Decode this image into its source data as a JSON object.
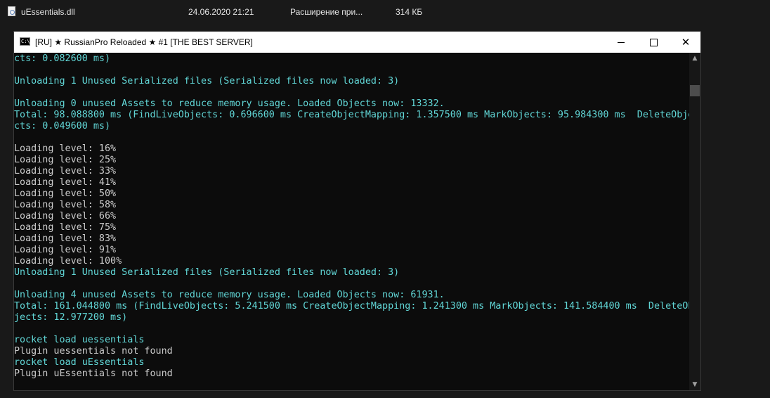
{
  "file_row": {
    "name": "uEssentials.dll",
    "date": "24.06.2020 21:21",
    "type": "Расширение при...",
    "size": "314 КБ"
  },
  "window": {
    "icon_text": "C:\\",
    "title": "[RU] ★ RussianPro Reloaded ★ #1 [THE BEST SERVER]"
  },
  "console_lines": [
    {
      "text": "cts: 0.082600 ms)",
      "color": "cyan"
    },
    {
      "text": "",
      "color": "white"
    },
    {
      "text": "Unloading 1 Unused Serialized files (Serialized files now loaded: 3)",
      "color": "cyan"
    },
    {
      "text": "",
      "color": "white"
    },
    {
      "text": "Unloading 0 unused Assets to reduce memory usage. Loaded Objects now: 13332.",
      "color": "cyan"
    },
    {
      "text": "Total: 98.088800 ms (FindLiveObjects: 0.696600 ms CreateObjectMapping: 1.357500 ms MarkObjects: 95.984300 ms  DeleteObje",
      "color": "cyan"
    },
    {
      "text": "cts: 0.049600 ms)",
      "color": "cyan"
    },
    {
      "text": "",
      "color": "white"
    },
    {
      "text": "Loading level: 16%",
      "color": "white"
    },
    {
      "text": "Loading level: 25%",
      "color": "white"
    },
    {
      "text": "Loading level: 33%",
      "color": "white"
    },
    {
      "text": "Loading level: 41%",
      "color": "white"
    },
    {
      "text": "Loading level: 50%",
      "color": "white"
    },
    {
      "text": "Loading level: 58%",
      "color": "white"
    },
    {
      "text": "Loading level: 66%",
      "color": "white"
    },
    {
      "text": "Loading level: 75%",
      "color": "white"
    },
    {
      "text": "Loading level: 83%",
      "color": "white"
    },
    {
      "text": "Loading level: 91%",
      "color": "white"
    },
    {
      "text": "Loading level: 100%",
      "color": "white"
    },
    {
      "text": "Unloading 1 Unused Serialized files (Serialized files now loaded: 3)",
      "color": "cyan"
    },
    {
      "text": "",
      "color": "white"
    },
    {
      "text": "Unloading 4 unused Assets to reduce memory usage. Loaded Objects now: 61931.",
      "color": "cyan"
    },
    {
      "text": "Total: 161.044800 ms (FindLiveObjects: 5.241500 ms CreateObjectMapping: 1.241300 ms MarkObjects: 141.584400 ms  DeleteOb",
      "color": "cyan"
    },
    {
      "text": "jects: 12.977200 ms)",
      "color": "cyan"
    },
    {
      "text": "",
      "color": "white"
    },
    {
      "text": "rocket load uessentials",
      "color": "cyan"
    },
    {
      "text": "Plugin uessentials not found",
      "color": "white"
    },
    {
      "text": "rocket load uEssentials",
      "color": "cyan"
    },
    {
      "text": "Plugin uEssentials not found",
      "color": "white"
    }
  ],
  "colors": {
    "console_bg": "#0c0c0c",
    "text_white": "#cccccc",
    "text_cyan": "#61d6d6",
    "titlebar_bg": "#ffffff"
  },
  "icons": {
    "minimize": "minimize-icon",
    "maximize": "maximize-icon",
    "close": "close-icon",
    "scroll_up": "chevron-up-icon",
    "scroll_down": "chevron-down-icon"
  }
}
